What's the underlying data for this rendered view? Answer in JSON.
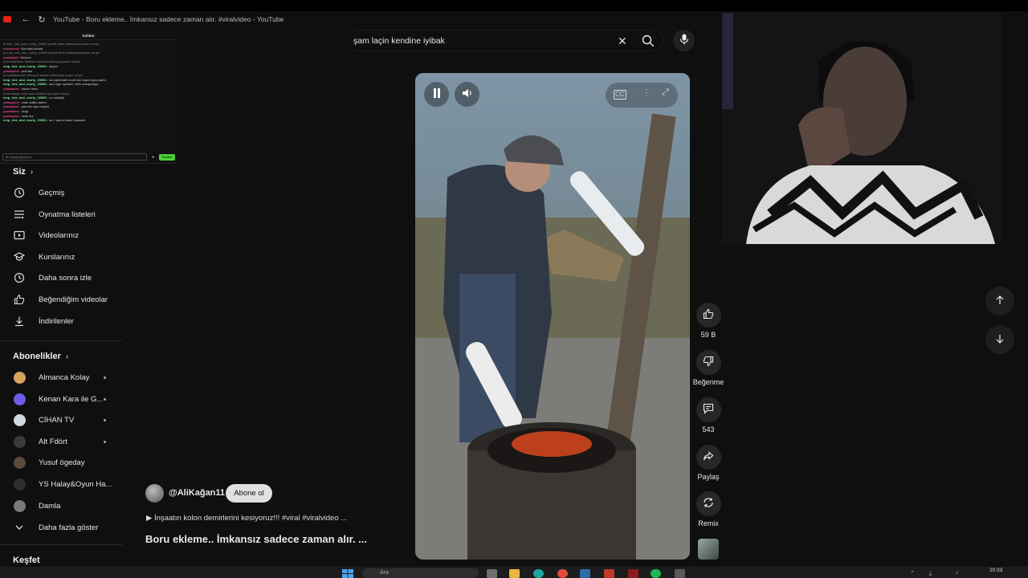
{
  "browser": {
    "tab_title": "YouTube - Boru ekleme.. İmkansız sadece zaman alır. #viralvideo - YouTube"
  },
  "chat": {
    "header": "Sohbet",
    "messages": [
      {
        "user": "",
        "text": "fs ieşe_rick_and_morty_20060 yoneff tarafı bullanıcıya yaanl verıye",
        "type": "sys",
        "color": "#888888"
      },
      {
        "user": "xxxxxxxxx",
        "text": "Nurullah Asrdla",
        "type": "msg",
        "color": "#e84393"
      },
      {
        "user": "",
        "text": "İy emp_rick_and_morty_20060 yoneff tarafı bullanıcıya yaanl verıye",
        "type": "sys",
        "color": "#888888"
      },
      {
        "user": "yzakaçkıri",
        "text": "Hosnev",
        "type": "msg",
        "color": "#e84393"
      },
      {
        "user": "",
        "text": "İy enoodmenn Ifdıreyıe sadan bullanıcıya yaanl veriye",
        "type": "sys",
        "color": "#888888"
      },
      {
        "user": "emp_rick_and_morty_20060:",
        "text": "ahyan",
        "type": "msg",
        "color": "#7bed9f"
      },
      {
        "user": "yzakaçkıri:",
        "text": "yest tas",
        "type": "msg",
        "color": "#e84393"
      },
      {
        "user": "",
        "text": "İy vustabaeırom Ifdıreyıe sadan bullanıcıya yaanl veriye",
        "type": "sys",
        "color": "#888888"
      },
      {
        "user": "emp_rick_and_morty_20060:",
        "text": "sol çipkürdeli murlt kub kayo bayo satmı",
        "type": "msg",
        "color": "#7bed9f"
      },
      {
        "user": "emp_rick_and_morty_20060:",
        "text": "ana olgu aşıkarılı erkin ansaymayo",
        "type": "msg",
        "color": "#7bed9f"
      },
      {
        "user": "yzakaçkıri:",
        "text": "hanne mehı",
        "type": "msg",
        "color": "#e84393"
      },
      {
        "user": "",
        "text": "İy ekmakapı toky saak bullanıcıya yaanl verıye",
        "type": "sys",
        "color": "#888888"
      },
      {
        "user": "emp_rick_and_morty_20060:",
        "text": "Lu mudlişö",
        "type": "msg",
        "color": "#7bed9f"
      },
      {
        "user": "yzakaçkıri:",
        "text": "onde sallim adem",
        "type": "msg",
        "color": "#e84393"
      },
      {
        "user": "yzakaçkıri:",
        "text": "yasi tes şişe bopaci",
        "type": "msg",
        "color": "#e84393"
      },
      {
        "user": "yzakaçkıri:",
        "text": "dcığı",
        "type": "msg",
        "color": "#e84393"
      },
      {
        "user": "yzakaçkıri:",
        "text": "nenk tes",
        "type": "msg",
        "color": "#e84393"
      },
      {
        "user": "emp_rick_and_morty_20060:",
        "text": "na 1 yarım kalan nipacalır",
        "type": "msg",
        "color": "#7bed9f"
      }
    ],
    "input_placeholder": "Bi mesaj gönderin",
    "send_label": "Sohbet"
  },
  "sidebar": {
    "you_title": "Siz",
    "you_items": [
      {
        "label": "Geçmiş",
        "icon": "history-icon"
      },
      {
        "label": "Oynatma listeleri",
        "icon": "playlists-icon"
      },
      {
        "label": "Videolarınız",
        "icon": "your-videos-icon"
      },
      {
        "label": "Kurslarınız",
        "icon": "courses-icon"
      },
      {
        "label": "Daha sonra izle",
        "icon": "watch-later-icon"
      },
      {
        "label": "Beğendiğim videolar",
        "icon": "liked-videos-icon"
      },
      {
        "label": "İndirilenler",
        "icon": "downloads-icon"
      }
    ],
    "subs_title": "Abonelikler",
    "subs": [
      {
        "label": "Almanca Kolay",
        "color": "#d8a25e",
        "dot": true
      },
      {
        "label": "Kenan Kara ile G...",
        "color": "#6c5ce7",
        "dot": true
      },
      {
        "label": "CİHAN TV",
        "color": "#cfd8dc",
        "dot": true
      },
      {
        "label": "Alt Fdört",
        "color": "#3a3a3a",
        "dot": true
      },
      {
        "label": "Yusuf ögeday",
        "color": "#5a4a3a",
        "dot": false
      },
      {
        "label": "YS Halay&Oyun Ha...",
        "color": "#2e2e2e",
        "dot": false
      },
      {
        "label": "Damla",
        "color": "#7a7a7a",
        "dot": false
      }
    ],
    "show_more": "Daha fazla göster",
    "explore_title": "Keşfet"
  },
  "search": {
    "query": "şam laçin kendine iyibak"
  },
  "video": {
    "channel": "@AliKağan11",
    "subscribe_label": "Abone ol",
    "description": "▶ İnşaatın kolon demirlerini kesiyoruz!!!  #viral #viralvideo ...",
    "title": "Boru ekleme.. İmkansız sadece zaman alır. ..."
  },
  "actions": {
    "like_count": "59 B",
    "dislike_label": "Beğenme",
    "comment_count": "543",
    "share_label": "Paylaş",
    "remix_label": "Remix"
  },
  "taskbar": {
    "search_placeholder": "Ara",
    "time": "20:33"
  },
  "colors": {
    "background": "#0f0f0f",
    "accent_red": "#e62117",
    "button_bg": "#272727"
  }
}
